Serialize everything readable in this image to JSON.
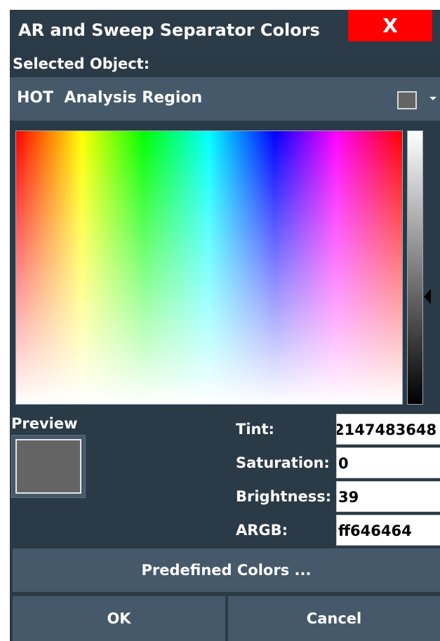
{
  "dialog": {
    "title": "AR and Sweep Separator Colors",
    "close_label": "X"
  },
  "selected_object": {
    "label": "Selected Object:",
    "value": "HOT  Analysis Region",
    "swatch_color": "#646464"
  },
  "preview": {
    "label": "Preview",
    "color": "#646464"
  },
  "fields": {
    "tint_label": "Tint:",
    "tint_value": "2147483648",
    "saturation_label": "Saturation:",
    "saturation_value": "0",
    "brightness_label": "Brightness:",
    "brightness_value": "39",
    "argb_label": "ARGB:",
    "argb_value": "ff646464"
  },
  "buttons": {
    "predefined": "Predefined Colors ...",
    "ok": "OK",
    "cancel": "Cancel"
  },
  "colors": {
    "background": "#2a3a47",
    "panel": "#45596a",
    "close_button": "#ff0000"
  }
}
